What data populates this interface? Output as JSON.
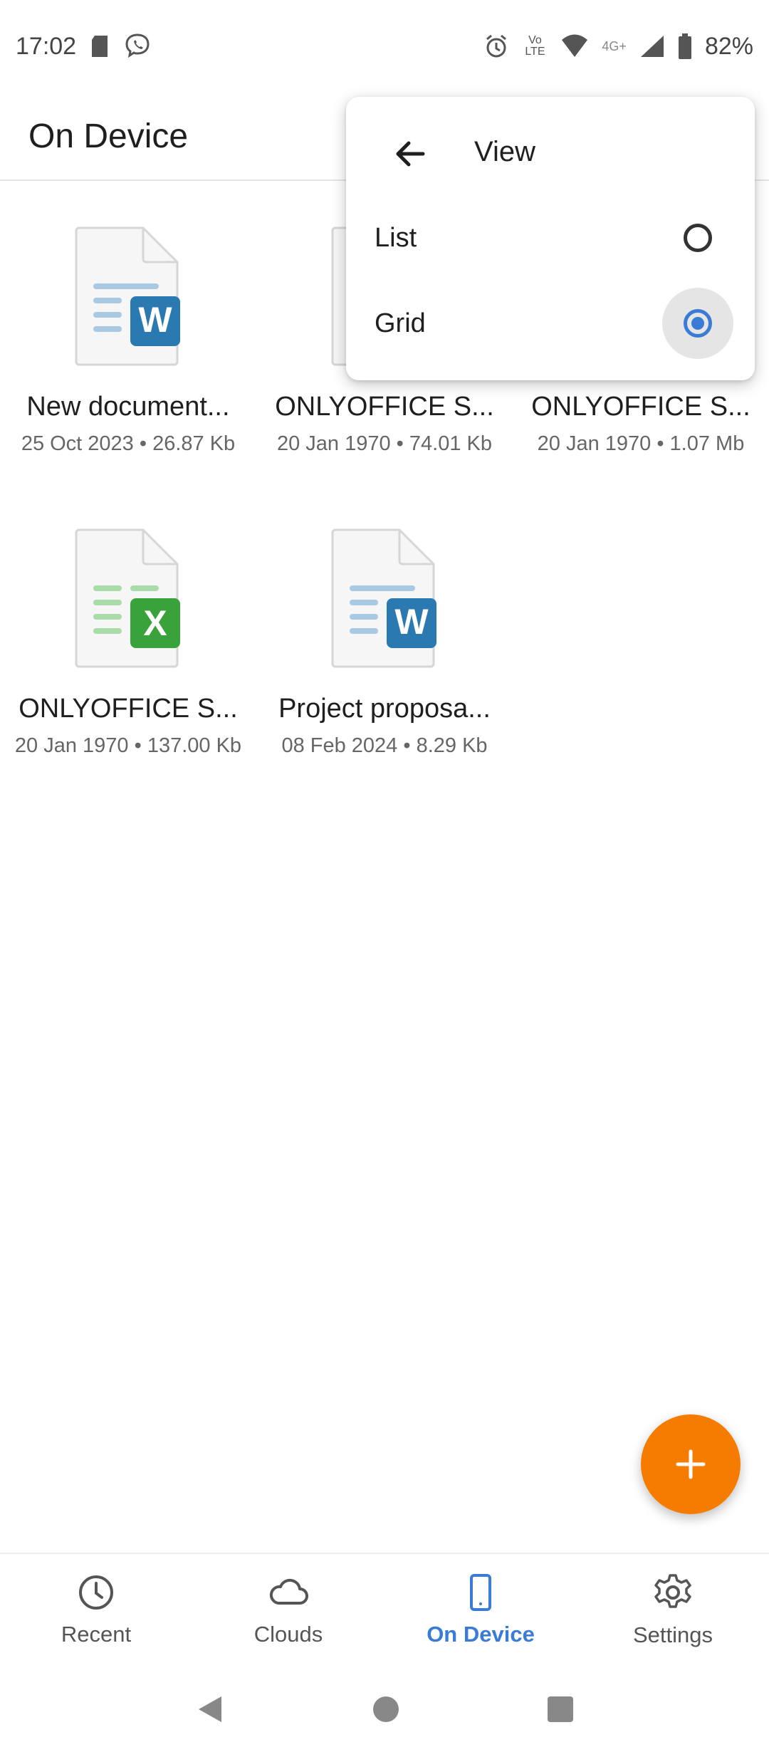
{
  "status_bar": {
    "time": "17:02",
    "network_label": "4G+",
    "volte_label": "Vo LTE",
    "battery": "82%"
  },
  "app_bar": {
    "title": "On Device"
  },
  "files": [
    {
      "name": "New document...",
      "meta": "25 Oct 2023 • 26.87 Kb",
      "type": "docx"
    },
    {
      "name": "ONLYOFFICE S...",
      "meta": "20 Jan 1970 • 74.01 Kb",
      "type": "docx"
    },
    {
      "name": "ONLYOFFICE S...",
      "meta": "20 Jan 1970 • 1.07 Mb",
      "type": "pptx"
    },
    {
      "name": "ONLYOFFICE S...",
      "meta": "20 Jan 1970 • 137.00 Kb",
      "type": "xlsx"
    },
    {
      "name": "Project proposa...",
      "meta": "08 Feb 2024 • 8.29 Kb",
      "type": "docx"
    }
  ],
  "view_menu": {
    "title": "View",
    "options": [
      {
        "label": "List",
        "selected": false
      },
      {
        "label": "Grid",
        "selected": true
      }
    ]
  },
  "bottom_nav": [
    {
      "label": "Recent",
      "icon": "clock-icon",
      "active": false
    },
    {
      "label": "Clouds",
      "icon": "cloud-icon",
      "active": false
    },
    {
      "label": "On Device",
      "icon": "phone-icon",
      "active": true
    },
    {
      "label": "Settings",
      "icon": "gear-icon",
      "active": false
    }
  ],
  "colors": {
    "accent": "#3a7bd5",
    "fab": "#f57c00",
    "word": "#2b79b1",
    "excel": "#3aa23a"
  }
}
